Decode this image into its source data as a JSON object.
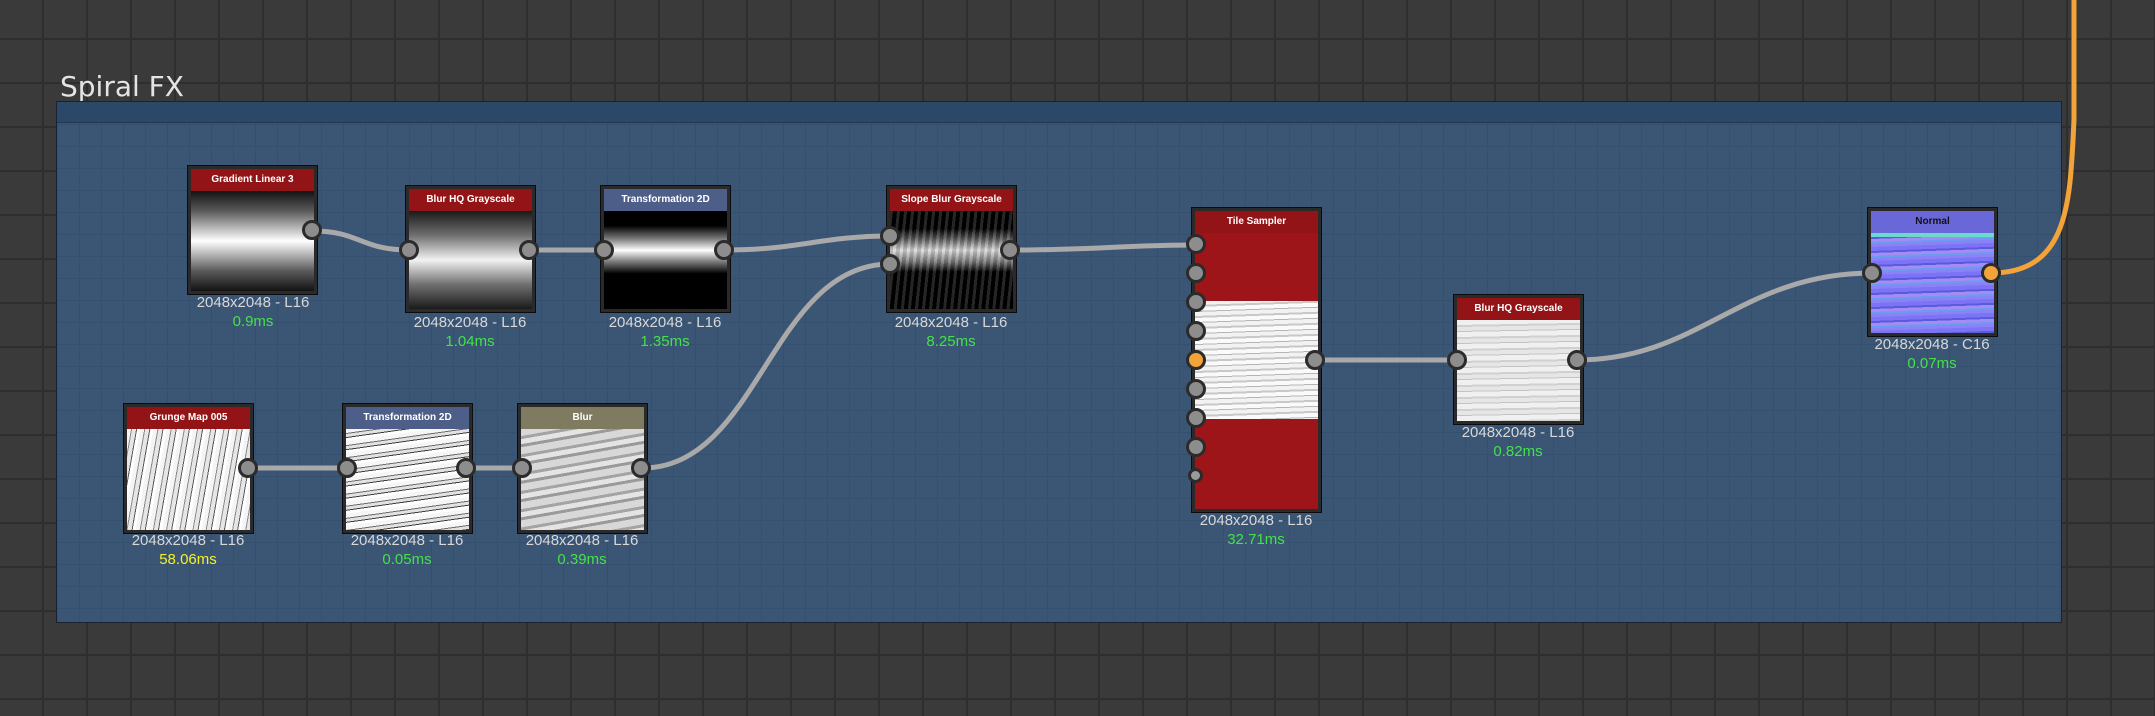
{
  "frame": {
    "title": "Spiral FX"
  },
  "nodes": [
    {
      "id": "gradient",
      "title": "Gradient Linear 3",
      "resolution": "2048x2048 - L16",
      "time": "0.9ms"
    },
    {
      "id": "blurhq1",
      "title": "Blur HQ Grayscale",
      "resolution": "2048x2048 - L16",
      "time": "1.04ms"
    },
    {
      "id": "transform1",
      "title": "Transformation 2D",
      "resolution": "2048x2048 - L16",
      "time": "1.35ms"
    },
    {
      "id": "slopeblur",
      "title": "Slope Blur Grayscale",
      "resolution": "2048x2048 - L16",
      "time": "8.25ms"
    },
    {
      "id": "tilesampler",
      "title": "Tile Sampler",
      "resolution": "2048x2048 - L16",
      "time": "32.71ms"
    },
    {
      "id": "blurhq2",
      "title": "Blur HQ Grayscale",
      "resolution": "2048x2048 - L16",
      "time": "0.82ms"
    },
    {
      "id": "normal",
      "title": "Normal",
      "resolution": "2048x2048 - C16",
      "time": "0.07ms"
    },
    {
      "id": "grunge",
      "title": "Grunge Map 005",
      "resolution": "2048x2048 - L16",
      "time": "58.06ms"
    },
    {
      "id": "transform2",
      "title": "Transformation 2D",
      "resolution": "2048x2048 - L16",
      "time": "0.05ms"
    },
    {
      "id": "blur",
      "title": "Blur",
      "resolution": "2048x2048 - L16",
      "time": "0.39ms"
    }
  ],
  "colors": {
    "frame_bg": "#3b5575",
    "header_generator": "#931416",
    "header_transform": "#4d5e88",
    "header_blur": "#7f7b60",
    "header_normal": "#6a68d8",
    "wire": "#a9a9a9",
    "wire_active": "#f2a43a",
    "time_fast": "#44e24a",
    "time_slow": "#f4f02a"
  }
}
